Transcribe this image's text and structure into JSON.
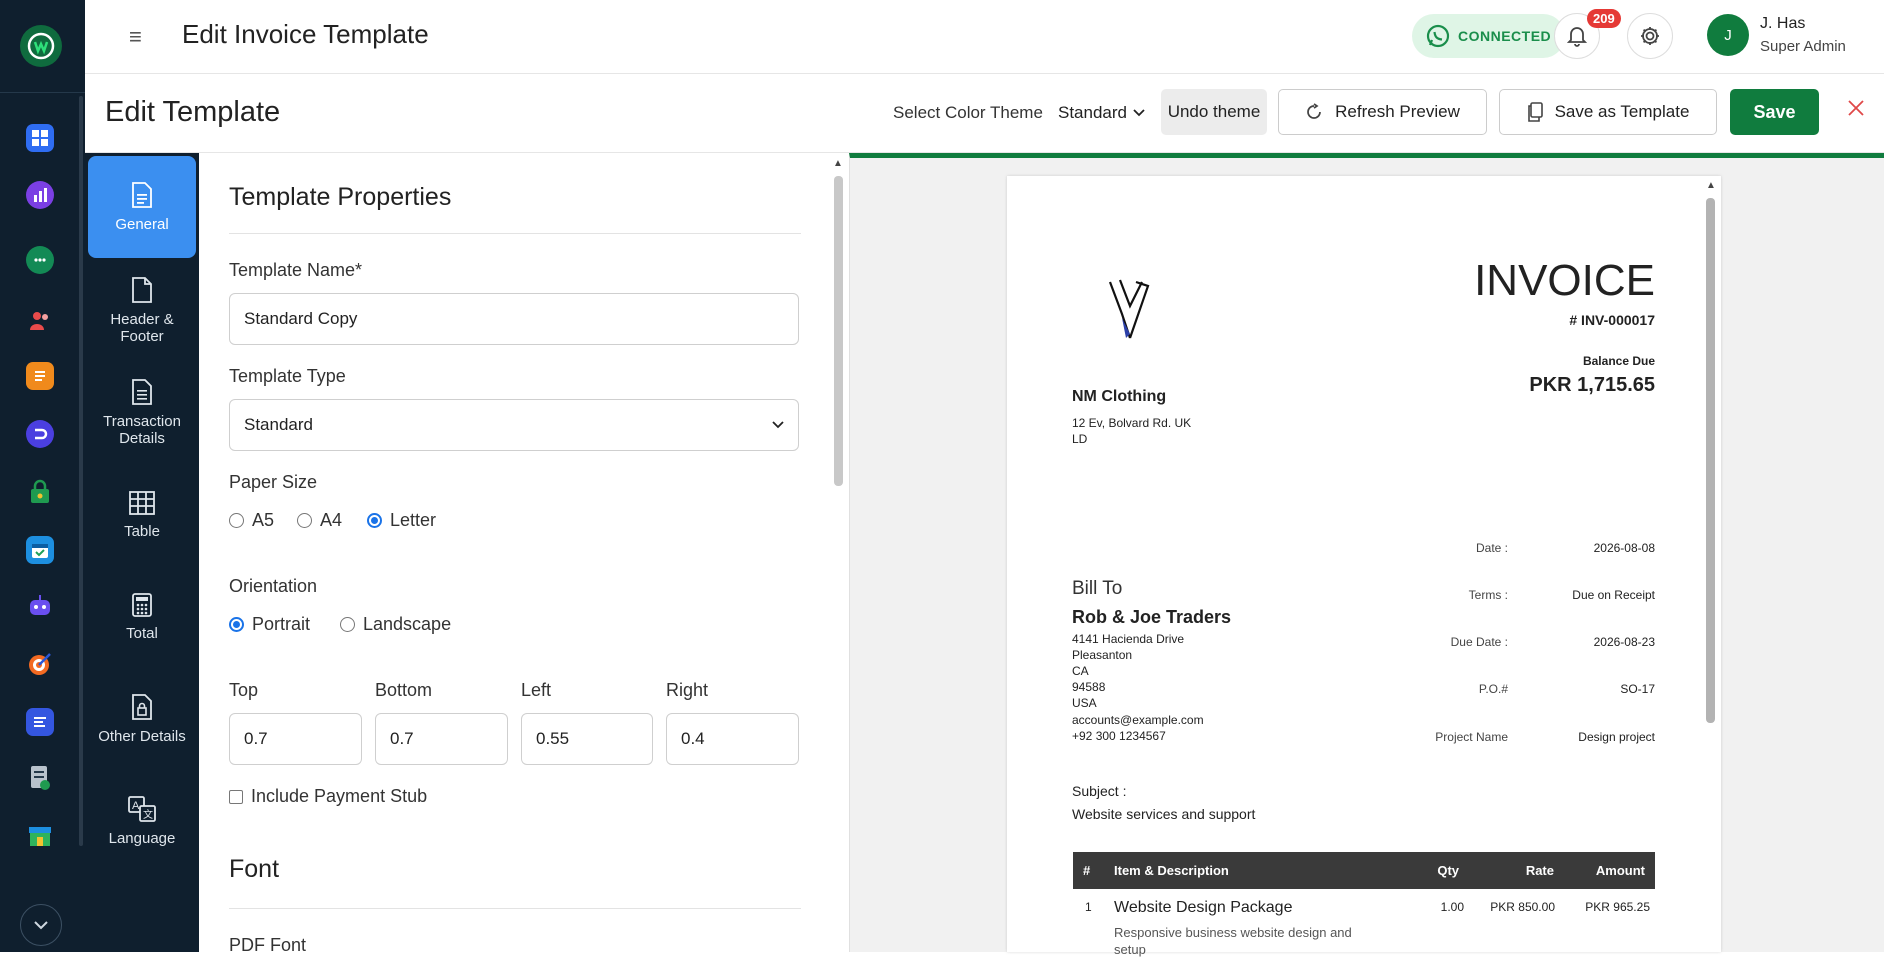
{
  "topbar": {
    "title": "Edit Invoice Template",
    "connection_status": "CONNECTED",
    "notification_count": "209",
    "user_initial": "J",
    "user_name": "J. Has",
    "user_role": "Super Admin"
  },
  "rail": {
    "icons": [
      "dashboard-icon",
      "analytics-icon",
      "chat-icon",
      "contacts-icon",
      "document-icon",
      "flow-icon",
      "lock-bag-icon",
      "calendar-icon",
      "bot-icon",
      "target-icon",
      "list-icon",
      "invoice-icon",
      "store-icon"
    ]
  },
  "subheader": {
    "title": "Edit Template",
    "theme_label": "Select Color Theme",
    "theme_value": "Standard",
    "undo_label": "Undo theme",
    "refresh_label": "Refresh Preview",
    "save_as_label": "Save as Template",
    "save_label": "Save"
  },
  "sidetabs": [
    {
      "label": "General",
      "icon": "document-icon",
      "active": true
    },
    {
      "label": "Header & Footer",
      "icon": "page-icon"
    },
    {
      "label": "Transaction Details",
      "icon": "lines-doc-icon"
    },
    {
      "label": "Table",
      "icon": "table-icon"
    },
    {
      "label": "Total",
      "icon": "calculator-icon"
    },
    {
      "label": "Other Details",
      "icon": "lock-doc-icon"
    },
    {
      "label": "Language",
      "icon": "translate-icon"
    }
  ],
  "form": {
    "section_title": "Template Properties",
    "name_label": "Template Name*",
    "name_value": "Standard Copy",
    "type_label": "Template Type",
    "type_value": "Standard",
    "paper_label": "Paper Size",
    "paper_options": [
      "A5",
      "A4",
      "Letter"
    ],
    "paper_selected": "Letter",
    "orientation_label": "Orientation",
    "orientation_options": [
      "Portrait",
      "Landscape"
    ],
    "orientation_selected": "Portrait",
    "margins": {
      "top_label": "Top",
      "top_value": "0.7",
      "bottom_label": "Bottom",
      "bottom_value": "0.7",
      "left_label": "Left",
      "left_value": "0.55",
      "right_label": "Right",
      "right_value": "0.4"
    },
    "stub_label": "Include Payment Stub",
    "font_section": "Font",
    "pdf_font_label": "PDF Font"
  },
  "invoice": {
    "title": "INVOICE",
    "number": "# INV-000017",
    "balance_label": "Balance Due",
    "balance_value": "PKR 1,715.65",
    "company_name": "NM Clothing",
    "company_addr1": "12 Ev, Bolvard Rd. UK",
    "company_addr2": "LD",
    "bill_to_label": "Bill To",
    "customer_name": "Rob & Joe Traders",
    "customer_lines": [
      "4141 Hacienda Drive",
      "Pleasanton",
      "CA",
      "94588",
      "USA",
      "accounts@example.com",
      "+92 300 1234567"
    ],
    "meta": [
      {
        "label": "Date :",
        "value": "2026-08-08"
      },
      {
        "label": "Terms :",
        "value": "Due on Receipt"
      },
      {
        "label": "Due Date :",
        "value": "2026-08-23"
      },
      {
        "label": "P.O.#",
        "value": "SO-17"
      },
      {
        "label": "Project Name",
        "value": "Design project"
      }
    ],
    "subject_label": "Subject :",
    "subject_value": "Website services and support",
    "table_headers": {
      "num": "#",
      "item": "Item & Description",
      "qty": "Qty",
      "rate": "Rate",
      "amount": "Amount"
    },
    "row1": {
      "num": "1",
      "item": "Website Design Package",
      "desc": "Responsive business website design and setup",
      "qty": "1.00",
      "rate": "PKR 850.00",
      "amount": "PKR 965.25"
    }
  },
  "colors": {
    "brand_green": "#107c3e",
    "rail_bg": "#0f1f2e",
    "active_tab": "#3b8ff0",
    "badge_red": "#e53935"
  }
}
